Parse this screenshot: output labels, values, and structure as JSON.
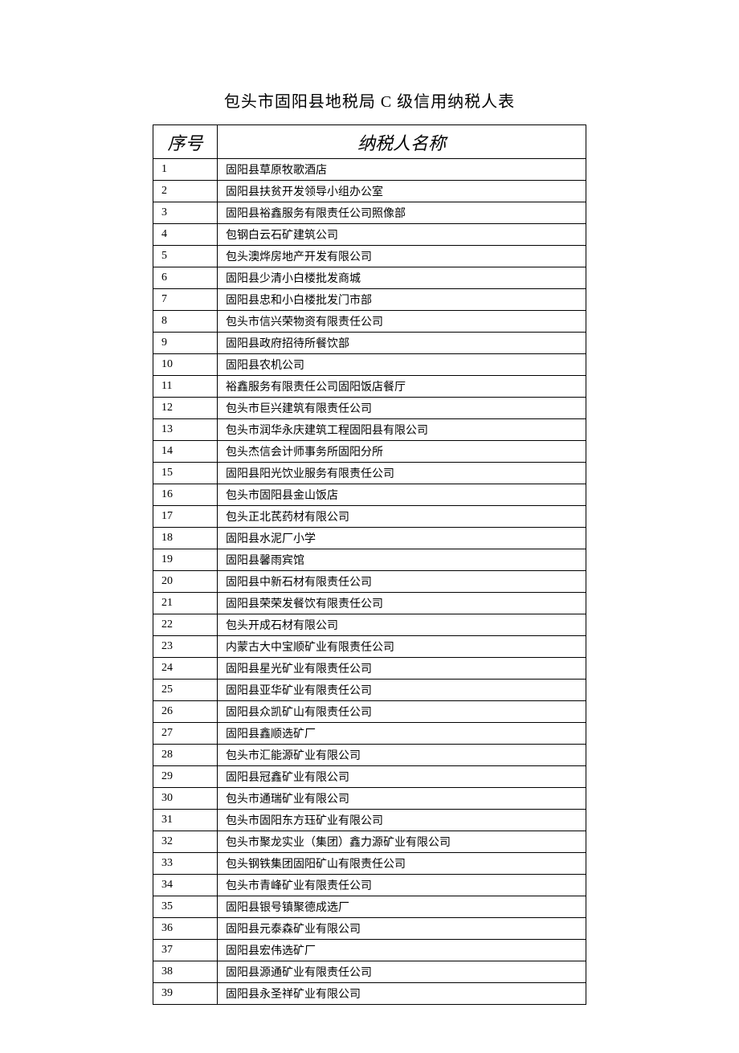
{
  "title": "包头市固阳县地税局 C 级信用纳税人表",
  "headers": {
    "index": "序号",
    "name": "纳税人名称"
  },
  "rows": [
    {
      "index": "1",
      "name": "固阳县草原牧歌酒店"
    },
    {
      "index": "2",
      "name": "固阳县扶贫开发领导小组办公室"
    },
    {
      "index": "3",
      "name": "固阳县裕鑫服务有限责任公司照像部"
    },
    {
      "index": "4",
      "name": "包钢白云石矿建筑公司"
    },
    {
      "index": "5",
      "name": "包头澳烨房地产开发有限公司"
    },
    {
      "index": "6",
      "name": "固阳县少清小白楼批发商城"
    },
    {
      "index": "7",
      "name": "固阳县忠和小白楼批发门市部"
    },
    {
      "index": "8",
      "name": "包头市信兴荣物资有限责任公司"
    },
    {
      "index": "9",
      "name": "固阳县政府招待所餐饮部"
    },
    {
      "index": "10",
      "name": "固阳县农机公司"
    },
    {
      "index": "11",
      "name": "裕鑫服务有限责任公司固阳饭店餐厅"
    },
    {
      "index": "12",
      "name": "包头市巨兴建筑有限责任公司"
    },
    {
      "index": "13",
      "name": "包头市润华永庆建筑工程固阳县有限公司"
    },
    {
      "index": "14",
      "name": "包头杰信会计师事务所固阳分所"
    },
    {
      "index": "15",
      "name": "固阳县阳光饮业服务有限责任公司"
    },
    {
      "index": "16",
      "name": "包头市固阳县金山饭店"
    },
    {
      "index": "17",
      "name": "包头正北芪药材有限公司"
    },
    {
      "index": "18",
      "name": "固阳县水泥厂小学"
    },
    {
      "index": "19",
      "name": "固阳县馨雨宾馆"
    },
    {
      "index": "20",
      "name": "固阳县中新石材有限责任公司"
    },
    {
      "index": "21",
      "name": "固阳县荣荣发餐饮有限责任公司"
    },
    {
      "index": "22",
      "name": "包头开成石材有限公司"
    },
    {
      "index": "23",
      "name": "内蒙古大中宝顺矿业有限责任公司"
    },
    {
      "index": "24",
      "name": "固阳县星光矿业有限责任公司"
    },
    {
      "index": "25",
      "name": "固阳县亚华矿业有限责任公司"
    },
    {
      "index": "26",
      "name": "固阳县众凯矿山有限责任公司"
    },
    {
      "index": "27",
      "name": "固阳县鑫顺选矿厂"
    },
    {
      "index": "28",
      "name": "包头市汇能源矿业有限公司"
    },
    {
      "index": "29",
      "name": "固阳县冠鑫矿业有限公司"
    },
    {
      "index": "30",
      "name": "包头市通瑞矿业有限公司"
    },
    {
      "index": "31",
      "name": "包头市固阳东方珏矿业有限公司"
    },
    {
      "index": "32",
      "name": "包头市聚龙实业（集团）鑫力源矿业有限公司"
    },
    {
      "index": "33",
      "name": "包头钢铁集团固阳矿山有限责任公司"
    },
    {
      "index": "34",
      "name": "包头市青峰矿业有限责任公司"
    },
    {
      "index": "35",
      "name": "固阳县银号镇聚德成选厂"
    },
    {
      "index": "36",
      "name": "固阳县元泰森矿业有限公司"
    },
    {
      "index": "37",
      "name": "固阳县宏伟选矿厂"
    },
    {
      "index": "38",
      "name": "固阳县源通矿业有限责任公司"
    },
    {
      "index": "39",
      "name": "固阳县永圣祥矿业有限公司"
    }
  ]
}
